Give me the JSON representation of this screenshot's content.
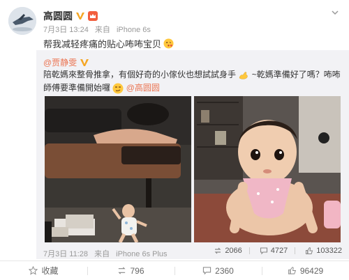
{
  "post": {
    "author": "高圆圆",
    "date": "7月3日 13:24",
    "source_prefix": "来自",
    "device": "iPhone 6s",
    "text": "帮我减轻疼痛的贴心咘咘宝贝"
  },
  "repost": {
    "author": "@贾静雯",
    "text_part1": "陪乾媽來整骨推拿，有個好奇的小傢伙也想試試身手",
    "text_part2": "~乾媽準備好了嗎？咘咘師傅要準備開始囉",
    "mention": "@高圆圆",
    "date": "7月3日 11:28",
    "source_prefix": "来自",
    "device": "iPhone 6s Plus",
    "stats": {
      "reposts": "2066",
      "comments": "4727",
      "likes": "103322"
    }
  },
  "actions": {
    "favorite": "收藏",
    "repost": "796",
    "comment": "2360",
    "like": "96429"
  },
  "colors": {
    "accent": "#eb7350",
    "verified": "#f5a623",
    "repost_bg": "#f2f2f5"
  }
}
